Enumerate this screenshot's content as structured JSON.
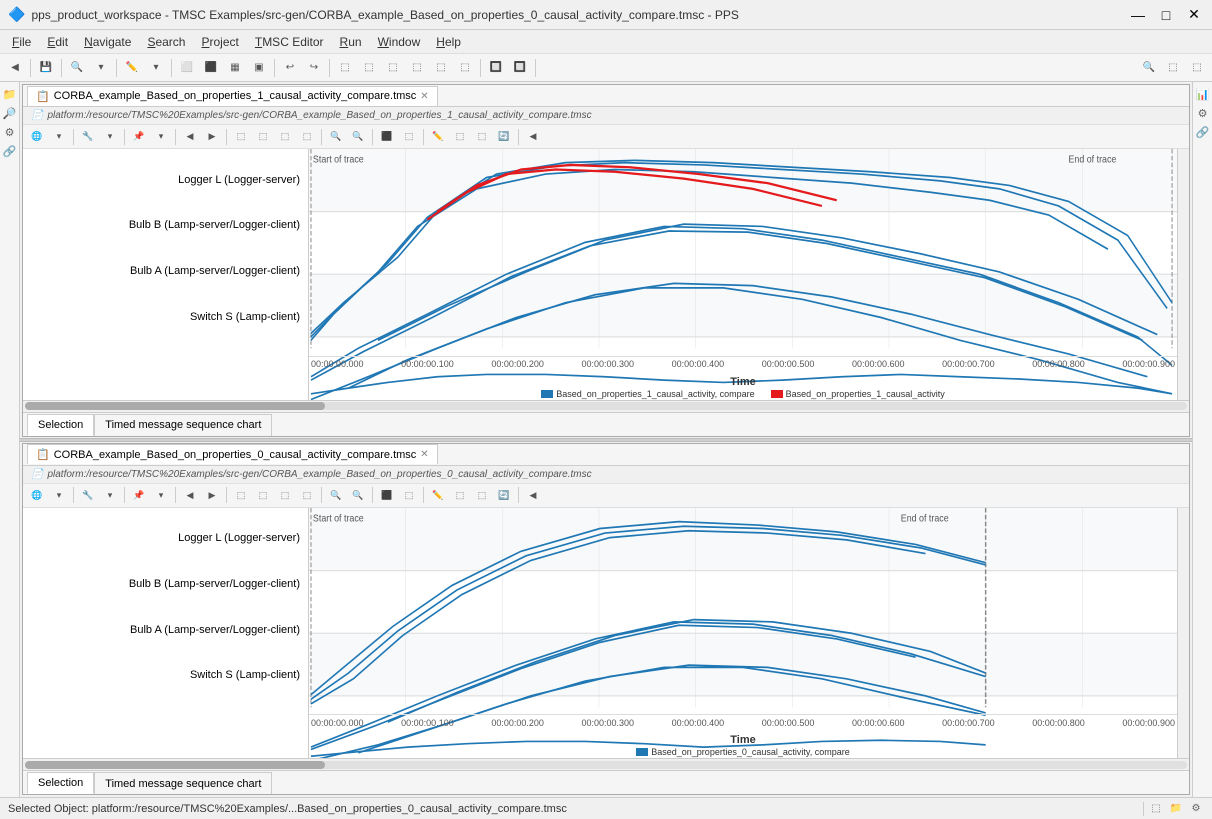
{
  "titleBar": {
    "icon": "🔷",
    "title": "pps_product_workspace - TMSC Examples/src-gen/CORBA_example_Based_on_properties_0_causal_activity_compare.tmsc - PPS",
    "minimize": "—",
    "maximize": "□",
    "close": "✕"
  },
  "menuBar": {
    "items": [
      "File",
      "Edit",
      "Navigate",
      "Search",
      "Project",
      "TMSC Editor",
      "Run",
      "Window",
      "Help"
    ]
  },
  "topPanel": {
    "tabName": "CORBA_example_Based_on_properties_1_causal_activity_compare.tmsc",
    "tabClose": "✕",
    "pathBar": "platform:/resource/TMSC%20Examples/src-gen/CORBA_example_Based_on_properties_1_causal_activity_compare.tmsc",
    "startLabel": "Start of trace",
    "endLabel": "End of trace",
    "labels": [
      "Logger L (Logger-server)",
      "Bulb B (Lamp-server/Logger-client)",
      "Bulb A (Lamp-server/Logger-client)",
      "Switch S (Lamp-client)"
    ],
    "timeAxis": [
      "00:00:00.000",
      "00:00:00.100",
      "00:00:00.200",
      "00:00:00.300",
      "00:00:00.400",
      "00:00:00.500",
      "00:00:00.600",
      "00:00:00.700",
      "00:00:00.800",
      "00:00:00.900"
    ],
    "timeTitle": "Time",
    "legend": [
      {
        "color": "#1f77b4",
        "label": "Based_on_properties_1_causal_activity, compare"
      },
      {
        "color": "#e41a1c",
        "label": "Based_on_properties_1_causal_activity"
      }
    ],
    "selectionTab": "Selection",
    "timedTab": "Timed message sequence chart"
  },
  "bottomPanel": {
    "tabName": "CORBA_example_Based_on_properties_0_causal_activity_compare.tmsc",
    "tabClose": "✕",
    "pathBar": "platform:/resource/TMSC%20Examples/src-gen/CORBA_example_Based_on_properties_0_causal_activity_compare.tmsc",
    "startLabel": "Start of trace",
    "endLabel": "End of trace",
    "labels": [
      "Logger L (Logger-server)",
      "Bulb B (Lamp-server/Logger-client)",
      "Bulb A (Lamp-server/Logger-client)",
      "Switch S (Lamp-client)"
    ],
    "timeAxis": [
      "00:00:00.000",
      "00:00:00.100",
      "00:00:00.200",
      "00:00:00.300",
      "00:00:00.400",
      "00:00:00.500",
      "00:00:00.600",
      "00:00:00.700",
      "00:00:00.800",
      "00:00:00.900"
    ],
    "timeTitle": "Time",
    "legend": [
      {
        "color": "#1f77b4",
        "label": "Based_on_properties_0_causal_activity, compare"
      }
    ],
    "selectionTab": "Selection",
    "timedTab": "Timed message sequence chart"
  },
  "statusBar": {
    "text": "Selected Object: platform:/resource/TMSC%20Examples/...Based_on_properties_0_causal_activity_compare.tmsc"
  },
  "colors": {
    "blue": "#1f77b4",
    "red": "#e41a1c",
    "background": "#f8f9fa",
    "chartBg": "#ffffff"
  }
}
